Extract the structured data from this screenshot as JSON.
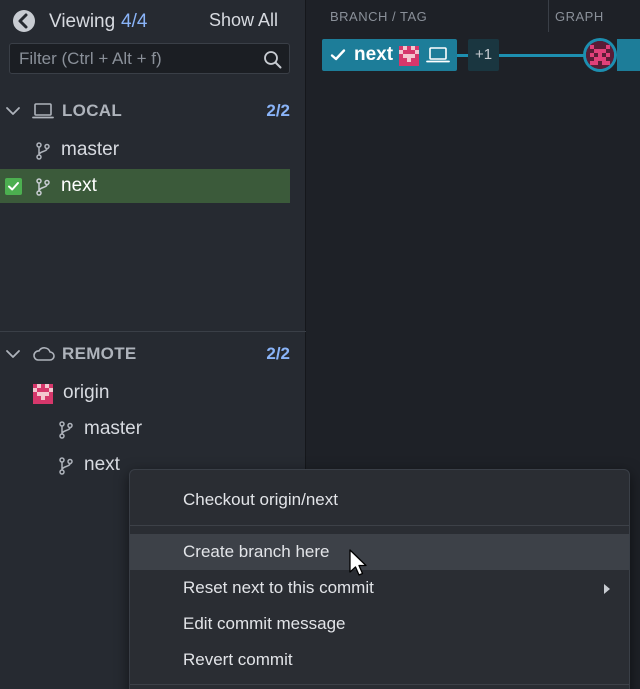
{
  "header": {
    "back_icon": "chevron-left-circle-icon",
    "viewing_label": "Viewing",
    "viewing_count": "4/4",
    "show_all_label": "Show All"
  },
  "filter": {
    "placeholder": "Filter (Ctrl + Alt + f)",
    "value": "",
    "icon": "search-icon"
  },
  "local": {
    "title": "LOCAL",
    "count": "2/2",
    "icon": "laptop-icon",
    "branches": [
      {
        "label": "master",
        "selected": false,
        "checked": false
      },
      {
        "label": "next",
        "selected": true,
        "checked": true
      }
    ]
  },
  "remote": {
    "title": "REMOTE",
    "count": "2/2",
    "icon": "cloud-icon",
    "remotes": [
      {
        "label": "origin",
        "branches": [
          {
            "label": "master"
          },
          {
            "label": "next"
          }
        ]
      }
    ]
  },
  "graph": {
    "col_branch_tag": "BRANCH / TAG",
    "col_graph": "GRAPH",
    "ref_label": "next",
    "more_refs": "+1",
    "accent_color": "#1d8fb0"
  },
  "context_menu": {
    "items": [
      {
        "label": "Checkout origin/next",
        "hover": false,
        "submenu": false
      },
      {
        "label": "Create branch here",
        "hover": true,
        "submenu": false
      },
      {
        "label": "Reset next to this commit",
        "hover": false,
        "submenu": true
      },
      {
        "label": "Edit commit message",
        "hover": false,
        "submenu": false
      },
      {
        "label": "Revert commit",
        "hover": false,
        "submenu": false
      }
    ]
  }
}
